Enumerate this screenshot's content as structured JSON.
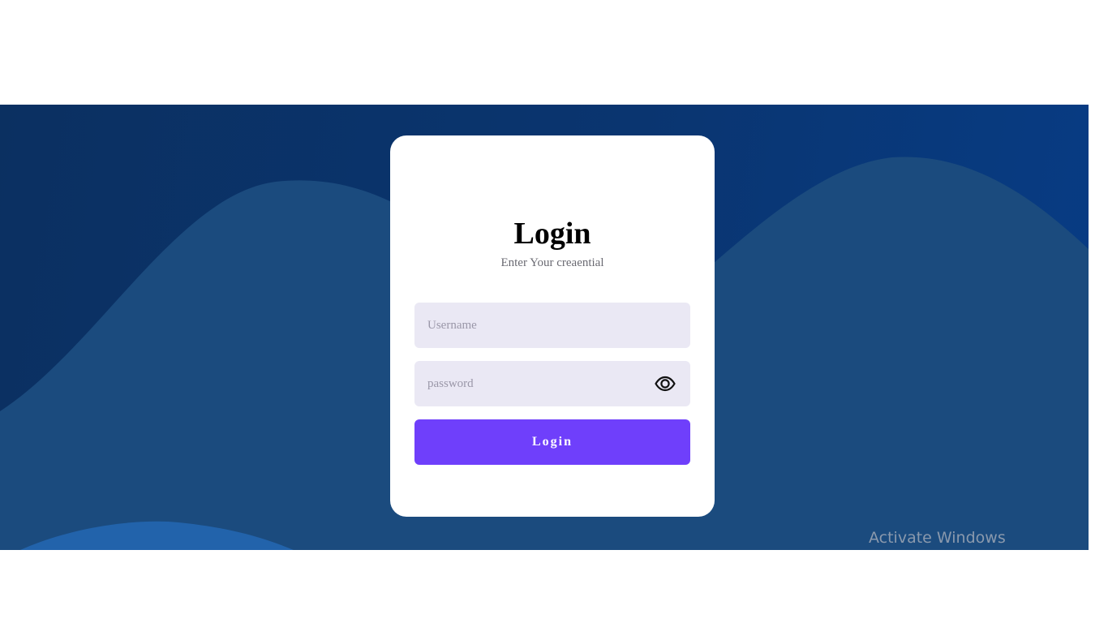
{
  "login_card": {
    "title": "Login",
    "subtitle": "Enter Your creaential",
    "username_placeholder": "Username",
    "password_placeholder": "password",
    "username_value": "",
    "password_value": "",
    "show_password_icon": "eye-icon",
    "submit_label": "Login"
  },
  "watermark": {
    "text": "Activate Windows"
  },
  "colors": {
    "background_dark": "#0b3061",
    "wave": "#1b4b7e",
    "wave_light": "#2263ab",
    "card": "#ffffff",
    "input_bg": "#eae8f4",
    "button": "#6f3ffb",
    "button_text": "#ffffff"
  }
}
